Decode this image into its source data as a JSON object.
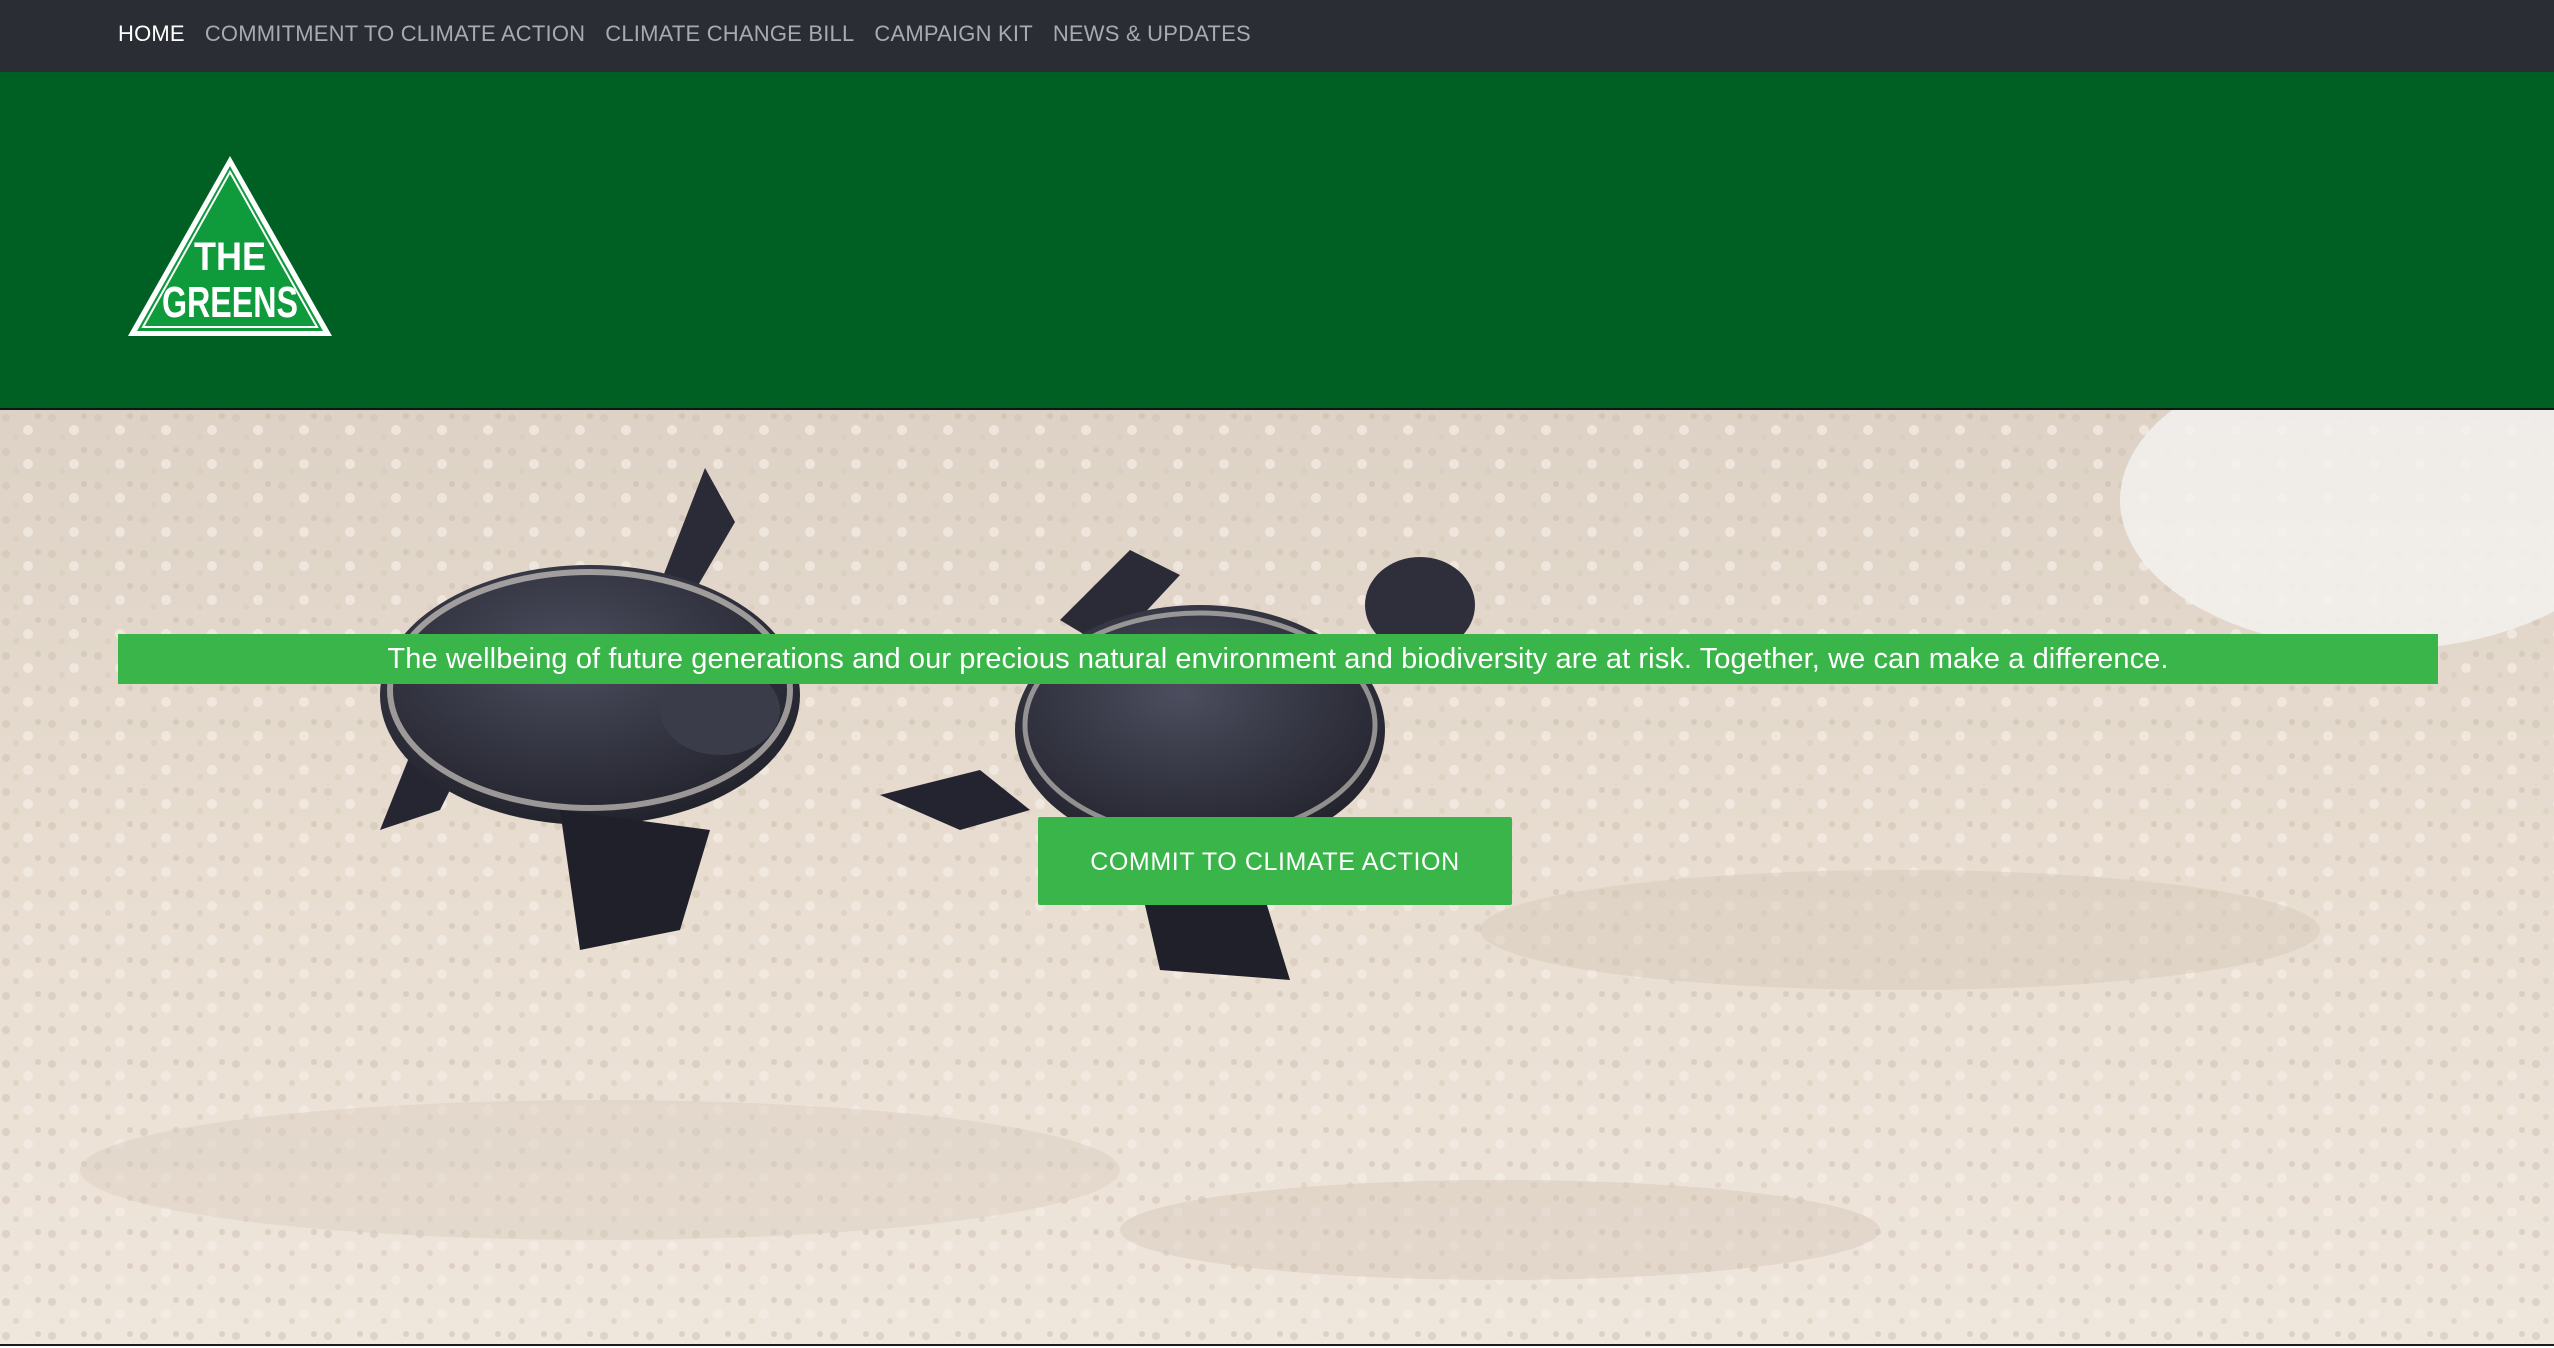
{
  "nav": {
    "items": [
      {
        "label": "HOME",
        "active": true
      },
      {
        "label": "COMMITMENT TO CLIMATE ACTION",
        "active": false
      },
      {
        "label": "CLIMATE CHANGE BILL",
        "active": false
      },
      {
        "label": "CAMPAIGN KIT",
        "active": false
      },
      {
        "label": "NEWS & UPDATES",
        "active": false
      }
    ]
  },
  "logo": {
    "line1": "THE",
    "line2": "GREENS"
  },
  "hero": {
    "banner_text": "The wellbeing of future generations and our precious natural environment and biodiversity are at risk. Together, we can make a difference.",
    "cta_label": "COMMIT TO CLIMATE ACTION"
  },
  "colors": {
    "nav_bg": "#2b2d35",
    "brand_green": "#006023",
    "accent_green": "#39b54a"
  }
}
